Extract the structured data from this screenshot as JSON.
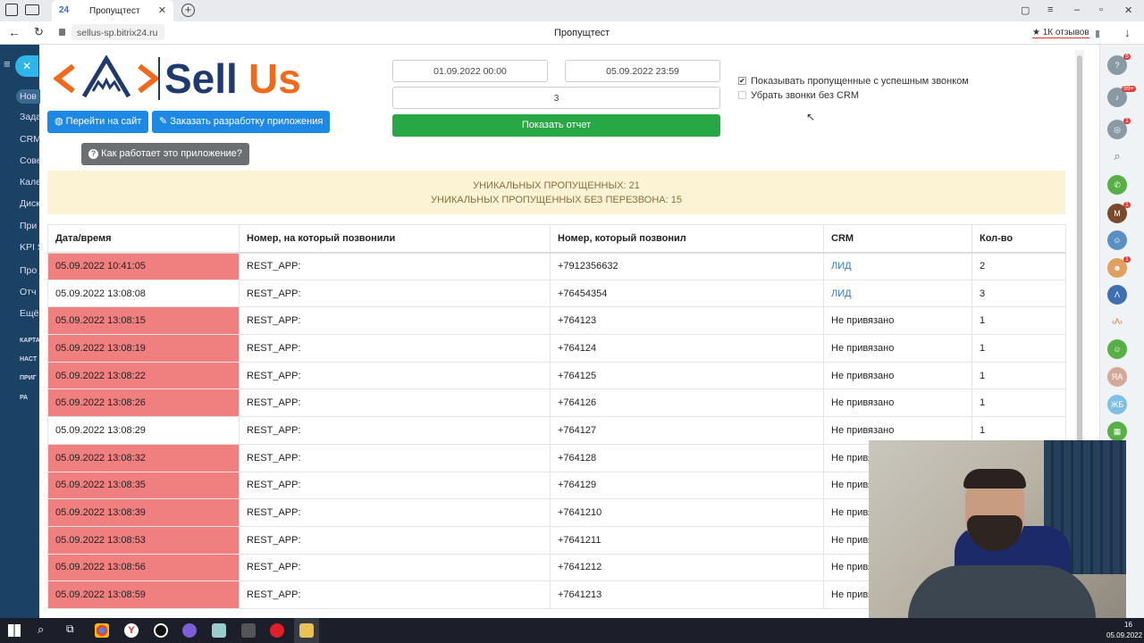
{
  "browser": {
    "tab_icon": "24",
    "tab_title": "Пропущтест",
    "url": "sellus-sp.bitrix24.ru",
    "page_title": "Пропущтест",
    "reviews_badge": "★ 1К отзывов"
  },
  "leftnav": {
    "items": [
      "Нов",
      "Зада",
      "CRM",
      "Сове",
      "Кале",
      "Диск",
      "При",
      "KPI S",
      "Про",
      "Отч",
      "Ещё",
      "КАРТА",
      "НАСТ",
      "ПРИГ",
      "РА"
    ]
  },
  "rightrail": {
    "badges": [
      "6",
      "99+",
      "1",
      "1",
      "1"
    ],
    "avatars": [
      "М",
      "ЯА",
      "ЖБ"
    ]
  },
  "app": {
    "logo_text_1": "Sell",
    "logo_text_2": "Us",
    "btn_site": "Перейти на сайт",
    "btn_order": "Заказать разработку приложения",
    "btn_help": "Как работает это приложение?",
    "date_from": "01.09.2022 00:00",
    "date_to": "05.09.2022 23:59",
    "count_value": "3",
    "btn_report": "Показать отчет",
    "chk_show_label": "Показывать пропущенные с успешным звонком",
    "chk_show_checked": true,
    "chk_hide_label": "Убрать звонки без CRM",
    "chk_hide_checked": false,
    "alert_line1": "УНИКАЛЬНЫХ ПРОПУЩЕННЫХ: 21",
    "alert_line2": "УНИКАЛЬНЫХ ПРОПУЩЕННЫХ БЕЗ ПЕРЕЗВОНА: 15"
  },
  "table": {
    "headers": [
      "Дата/время",
      "Номер, на который позвонили",
      "Номер, который позвонил",
      "CRM",
      "Кол-во"
    ],
    "rows": [
      {
        "date": "05.09.2022 10:41:05",
        "to": "REST_APP:",
        "from": "+7912356632",
        "crm": "ЛИД",
        "count": "2",
        "missed": true,
        "link": true
      },
      {
        "date": "05.09.2022 13:08:08",
        "to": "REST_APP:",
        "from": "+76454354",
        "crm": "ЛИД",
        "count": "3",
        "missed": false,
        "link": true
      },
      {
        "date": "05.09.2022 13:08:15",
        "to": "REST_APP:",
        "from": "+764123",
        "crm": "Не привязано",
        "count": "1",
        "missed": true,
        "link": false
      },
      {
        "date": "05.09.2022 13:08:19",
        "to": "REST_APP:",
        "from": "+764124",
        "crm": "Не привязано",
        "count": "1",
        "missed": true,
        "link": false
      },
      {
        "date": "05.09.2022 13:08:22",
        "to": "REST_APP:",
        "from": "+764125",
        "crm": "Не привязано",
        "count": "1",
        "missed": true,
        "link": false
      },
      {
        "date": "05.09.2022 13:08:26",
        "to": "REST_APP:",
        "from": "+764126",
        "crm": "Не привязано",
        "count": "1",
        "missed": true,
        "link": false
      },
      {
        "date": "05.09.2022 13:08:29",
        "to": "REST_APP:",
        "from": "+764127",
        "crm": "Не привязано",
        "count": "1",
        "missed": false,
        "link": false
      },
      {
        "date": "05.09.2022 13:08:32",
        "to": "REST_APP:",
        "from": "+764128",
        "crm": "Не привяз",
        "count": "",
        "missed": true,
        "link": false
      },
      {
        "date": "05.09.2022 13:08:35",
        "to": "REST_APP:",
        "from": "+764129",
        "crm": "Не привяз",
        "count": "",
        "missed": true,
        "link": false
      },
      {
        "date": "05.09.2022 13:08:39",
        "to": "REST_APP:",
        "from": "+7641210",
        "crm": "Не привяз",
        "count": "",
        "missed": true,
        "link": false
      },
      {
        "date": "05.09.2022 13:08:53",
        "to": "REST_APP:",
        "from": "+7641211",
        "crm": "Не привяз",
        "count": "",
        "missed": true,
        "link": false
      },
      {
        "date": "05.09.2022 13:08:56",
        "to": "REST_APP:",
        "from": "+7641212",
        "crm": "Не привяз",
        "count": "",
        "missed": true,
        "link": false
      },
      {
        "date": "05.09.2022 13:08:59",
        "to": "REST_APP:",
        "from": "+7641213",
        "crm": "Не привяз",
        "count": "",
        "missed": true,
        "link": false
      }
    ]
  },
  "taskbar": {
    "time": "16",
    "date": "05.09.2022"
  },
  "colors": {
    "missed_row": "#f07f7f",
    "primary": "#1e88e5",
    "success": "#28a745",
    "logo_orange": "#f06a1a",
    "logo_blue": "#1f3a6e"
  }
}
